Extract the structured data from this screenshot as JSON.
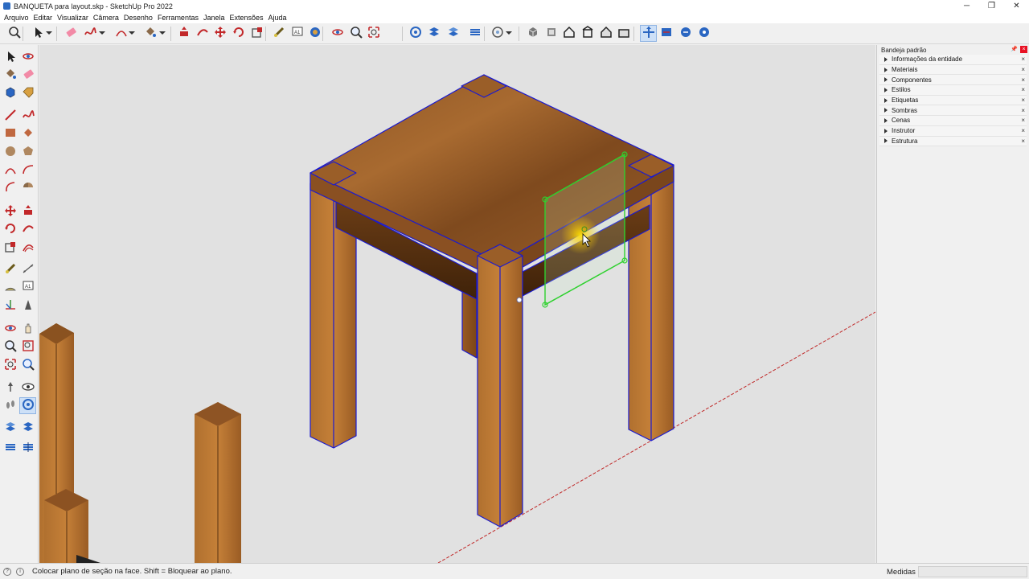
{
  "window": {
    "title": "BANQUETA para layout.skp - SketchUp Pro 2022",
    "minimize": "─",
    "restore": "❐",
    "close": "✕"
  },
  "menu": [
    "Arquivo",
    "Editar",
    "Visualizar",
    "Câmera",
    "Desenho",
    "Ferramentas",
    "Janela",
    "Extensões",
    "Ajuda"
  ],
  "toolbar_icons": [
    "search-icon",
    "select-arrow-icon",
    "dropdown-icon",
    "eraser-icon",
    "freehand-icon",
    "dropdown-icon",
    "arc-icon",
    "dropdown-icon",
    "paint-bucket-icon",
    "dropdown-icon",
    "push-pull-icon",
    "follow-me-icon",
    "move-icon",
    "rotate-icon",
    "scale-icon",
    "tape-measure-icon",
    "text-icon",
    "paint-icon",
    "orbit-icon",
    "zoom-icon",
    "zoom-extents-icon",
    "section-plane-icon",
    "section-cut-icon",
    "section-fill-icon",
    "section-display-icon",
    "sandbox-icon",
    "dropdown-icon",
    "iso-view-icon",
    "top-view-icon",
    "front-view-icon",
    "right-view-icon",
    "back-view-icon",
    "left-view-icon",
    "section-tool-icon",
    "section-plane-display-icon",
    "section-cuts-icon",
    "section-fill-toggle-icon"
  ],
  "left_tool_icons": [
    "select-icon",
    "orbit-icon",
    "paint-bucket-icon",
    "eraser-icon",
    "component-icon",
    "tag-icon",
    "line-icon",
    "freehand-icon",
    "rectangle-icon",
    "rotated-rect-icon",
    "circle-icon",
    "polygon-icon",
    "arc-icon",
    "two-point-arc-icon",
    "three-point-arc-icon",
    "pie-icon",
    "move-icon",
    "push-pull-icon",
    "rotate-icon",
    "follow-me-icon",
    "scale-icon",
    "offset-icon",
    "tape-measure-icon",
    "dimension-icon",
    "protractor-icon",
    "text-icon",
    "axes-icon",
    "3d-text-icon",
    "orbit-icon",
    "pan-icon",
    "zoom-icon",
    "zoom-window-icon",
    "zoom-extents-icon",
    "previous-view-icon",
    "position-camera-icon",
    "look-around-icon",
    "walk-icon",
    "section-plane-icon",
    "section-fill-icon",
    "section-cut-icon",
    "section-display-icon",
    "section-planes-icon"
  ],
  "tray": {
    "title": "Bandeja padrão",
    "pin": "📌",
    "close": "×",
    "items": [
      "Informações da entidade",
      "Materiais",
      "Componentes",
      "Estilos",
      "Etiquetas",
      "Sombras",
      "Cenas",
      "Instrutor",
      "Estrutura"
    ]
  },
  "status": {
    "message": "Colocar plano de seção na face. Shift = Bloquear ao plano.",
    "measure_label": "Medidas",
    "measure_value": ""
  },
  "colors": {
    "wood_light": "#a8672c",
    "wood_dark": "#5a3414",
    "edge": "#1a1ad0",
    "section": "#2ed12e",
    "axis": "#c02828"
  }
}
